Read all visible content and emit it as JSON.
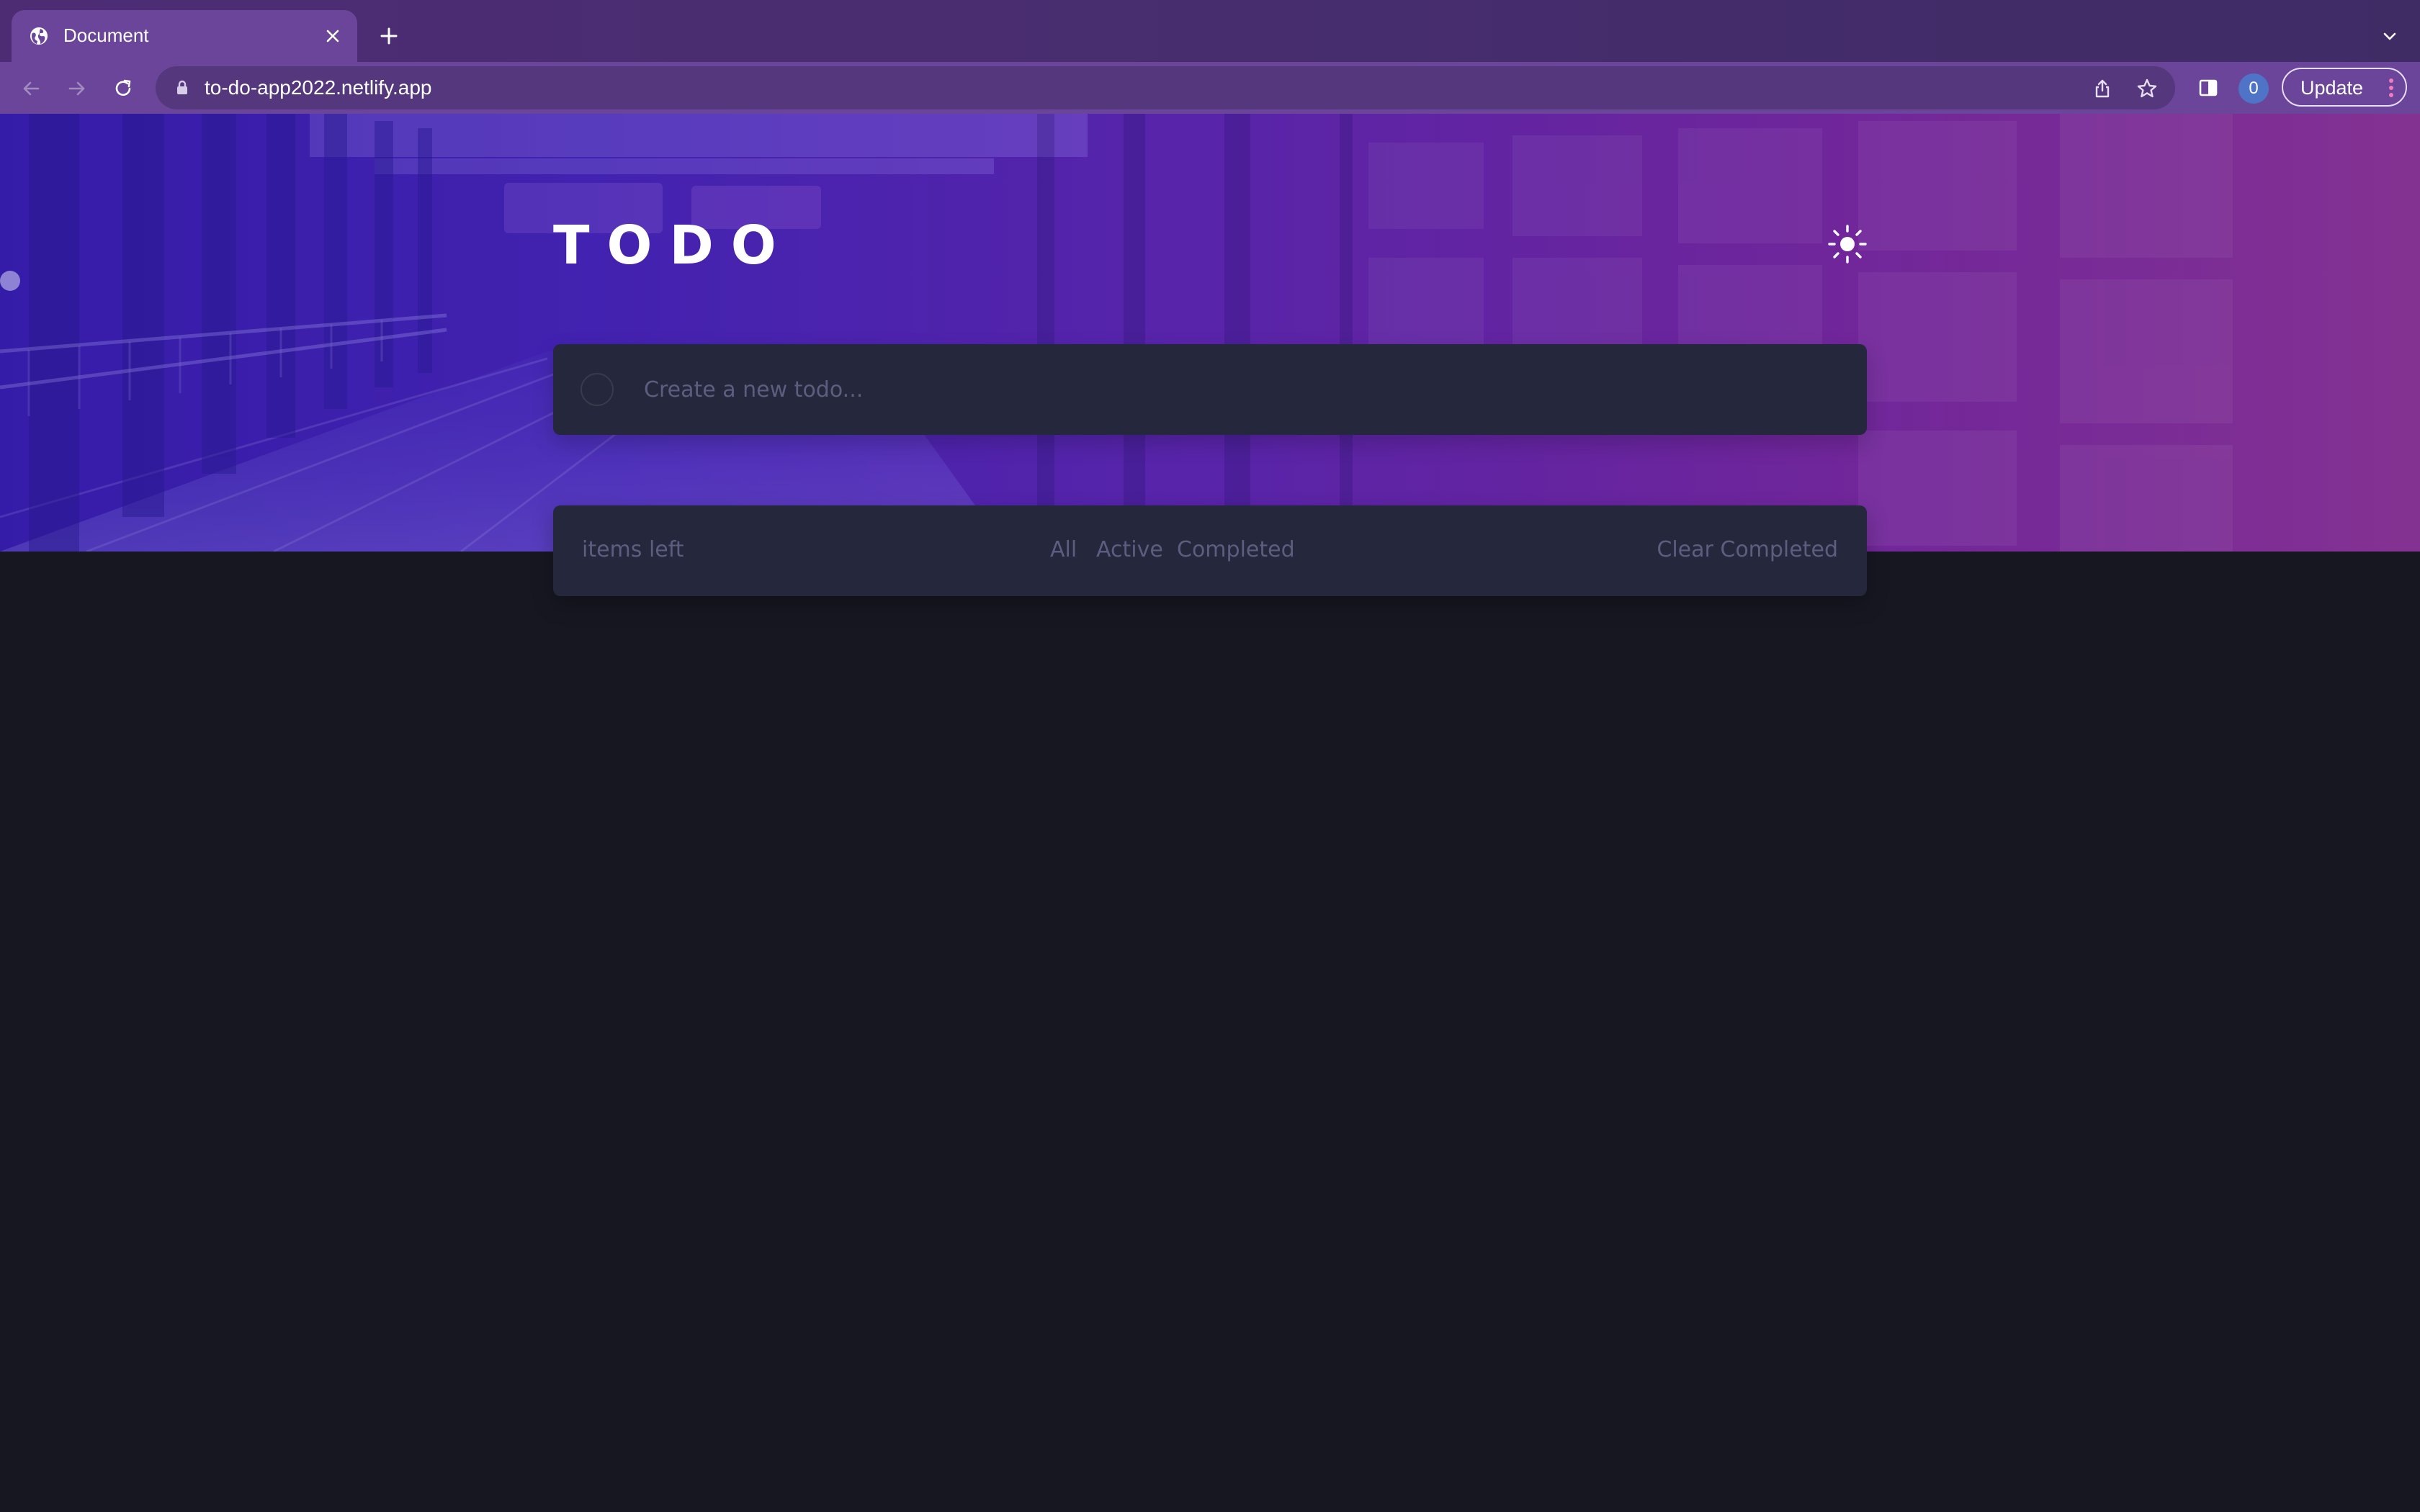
{
  "browser": {
    "tab": {
      "title": "Document",
      "favicon": "globe-icon"
    },
    "toolbar": {
      "url": "to-do-app2022.netlify.app",
      "profile_badge": "0",
      "update_label": "Update"
    },
    "icons": {
      "close": "close-icon",
      "new_tab": "plus-icon",
      "tab_menu": "chevron-down-icon",
      "back": "arrow-left-icon",
      "forward": "arrow-right-icon",
      "reload": "reload-icon",
      "lock": "lock-icon",
      "share": "share-icon",
      "bookmark": "star-icon",
      "side_panel": "side-panel-icon",
      "menu": "more-vertical-icon"
    }
  },
  "app": {
    "title": "TODO",
    "theme_toggle_icon": "sun-icon",
    "new_todo": {
      "placeholder": "Create a new todo..."
    },
    "footer": {
      "items_left": "items left",
      "filters": {
        "all": "All",
        "active": "Active",
        "completed": "Completed"
      },
      "clear_completed": "Clear Completed"
    }
  },
  "colors": {
    "chrome_tab": "#6b4599",
    "chrome_tab_strip": "#492d70",
    "omnibox": "#55377d",
    "page_background": "#171722",
    "card_background": "#25273c",
    "muted_text": "#5b5e7e",
    "hero_left": "#3b1fbb",
    "hero_right": "#7f2a8e"
  }
}
